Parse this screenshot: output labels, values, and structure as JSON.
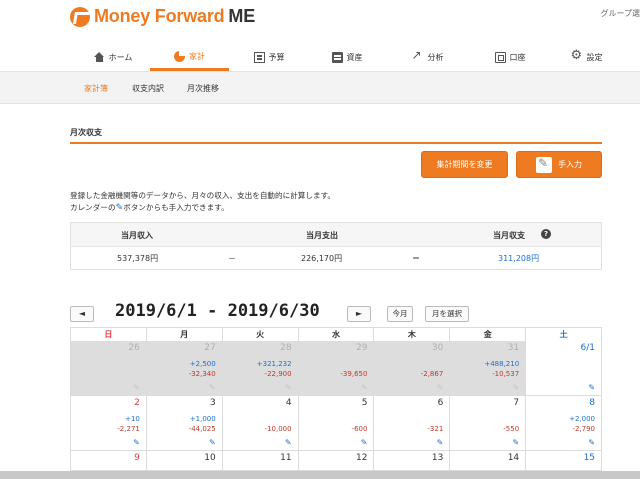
{
  "header": {
    "brand": "Money Forward",
    "brand_suffix": "ME",
    "group_link": "グループ選"
  },
  "nav": [
    {
      "label": "ホーム",
      "icon": "home-icon"
    },
    {
      "label": "家計",
      "icon": "pie-chart-icon",
      "active": true
    },
    {
      "label": "予算",
      "icon": "budget-icon"
    },
    {
      "label": "資産",
      "icon": "asset-icon"
    },
    {
      "label": "分析",
      "icon": "analysis-icon"
    },
    {
      "label": "口座",
      "icon": "account-icon"
    },
    {
      "label": "設定",
      "icon": "gear-icon"
    }
  ],
  "subnav": [
    {
      "label": "家計簿",
      "active": true
    },
    {
      "label": "収支内訳"
    },
    {
      "label": "月次推移"
    }
  ],
  "section_title": "月次収支",
  "buttons": {
    "period": "集計期間を変更",
    "manual": "手入力"
  },
  "description": {
    "line1": "登録した金融機関等のデータから、月々の収入、支出を自動的に計算します。",
    "line2_pre": "カレンダーの",
    "line2_post": "ボタンからも手入力できます。"
  },
  "summary": {
    "income_label": "当月収入",
    "expense_label": "当月支出",
    "balance_label": "当月収支",
    "income": "537,378円",
    "minus": "－",
    "expense": "226,170円",
    "equals": "＝",
    "balance": "311,208円"
  },
  "calendar": {
    "prev": "◄",
    "next": "►",
    "title": "2019/6/1 - 2019/6/30",
    "this_month": "今月",
    "select_month": "月を選択",
    "weekdays": [
      "日",
      "月",
      "火",
      "水",
      "木",
      "金",
      "土"
    ],
    "weeks": [
      [
        {
          "day": "26",
          "out": true,
          "inc": "",
          "exp": ""
        },
        {
          "day": "27",
          "out": true,
          "inc": "+2,500",
          "exp": "-32,340"
        },
        {
          "day": "28",
          "out": true,
          "inc": "+321,232",
          "exp": "-22,900"
        },
        {
          "day": "29",
          "out": true,
          "inc": "",
          "exp": "-39,650"
        },
        {
          "day": "30",
          "out": true,
          "inc": "",
          "exp": "-2,867"
        },
        {
          "day": "31",
          "out": true,
          "inc": "+488,210",
          "exp": "-10,537"
        },
        {
          "day": "6/1",
          "out": false,
          "inc": "",
          "exp": ""
        }
      ],
      [
        {
          "day": "2",
          "out": false,
          "inc": "+10",
          "exp": "-2,271"
        },
        {
          "day": "3",
          "out": false,
          "inc": "+1,000",
          "exp": "-44,025"
        },
        {
          "day": "4",
          "out": false,
          "inc": "",
          "exp": "-10,000"
        },
        {
          "day": "5",
          "out": false,
          "inc": "",
          "exp": "-600"
        },
        {
          "day": "6",
          "out": false,
          "inc": "",
          "exp": "-321"
        },
        {
          "day": "7",
          "out": false,
          "inc": "",
          "exp": "-550"
        },
        {
          "day": "8",
          "out": false,
          "inc": "+2,000",
          "exp": "-2,790"
        }
      ],
      [
        {
          "day": "9",
          "out": false
        },
        {
          "day": "10",
          "out": false
        },
        {
          "day": "11",
          "out": false
        },
        {
          "day": "12",
          "out": false
        },
        {
          "day": "13",
          "out": false
        },
        {
          "day": "14",
          "out": false
        },
        {
          "day": "15",
          "out": false
        }
      ]
    ]
  }
}
